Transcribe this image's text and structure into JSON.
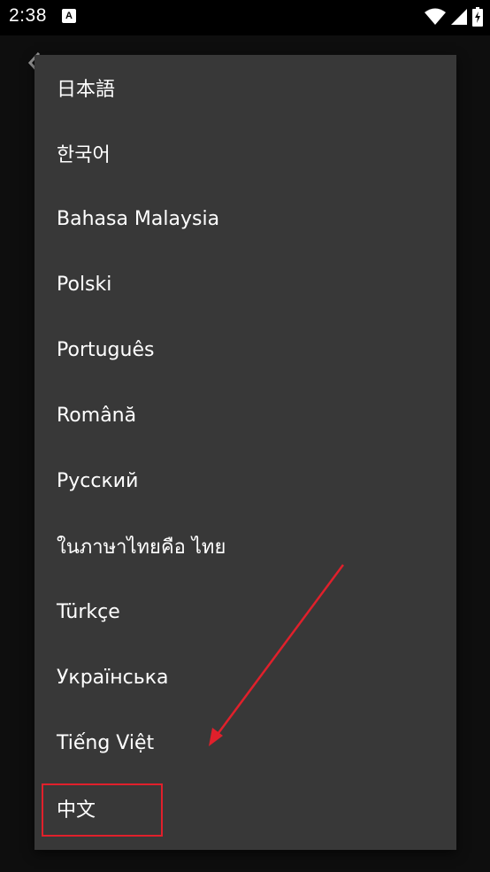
{
  "status_bar": {
    "time": "2:38",
    "notification_icon": "A"
  },
  "menu": {
    "items": [
      {
        "label": "日本語"
      },
      {
        "label": "한국어"
      },
      {
        "label": "Bahasa Malaysia"
      },
      {
        "label": "Polski"
      },
      {
        "label": "Português"
      },
      {
        "label": "Română"
      },
      {
        "label": "Русский"
      },
      {
        "label": "ในภาษาไทยคือ ไทย"
      },
      {
        "label": "Türkçe"
      },
      {
        "label": "Українська"
      },
      {
        "label": "Tiếng Việt"
      },
      {
        "label": "中文"
      }
    ]
  },
  "colors": {
    "menu_bg": "#383838",
    "annotation_red": "#e0202b",
    "text": "#ffffff"
  },
  "icons": [
    "wifi-icon",
    "signal-icon",
    "battery-icon",
    "back-arrow-icon"
  ]
}
